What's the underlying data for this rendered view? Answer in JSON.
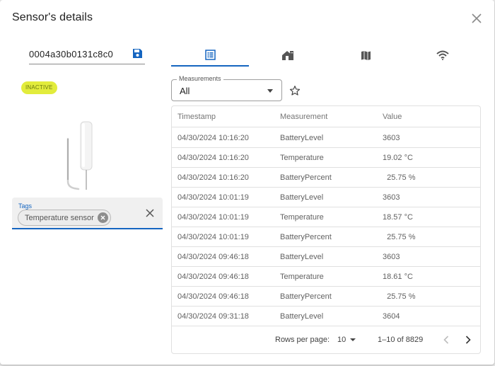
{
  "dialog": {
    "title": "Sensor's details",
    "close_icon": "close-icon"
  },
  "sensor": {
    "id": "0004a30b0131c8c0",
    "save_icon": "save-icon",
    "status": "INACTIVE",
    "image_icon": "temperature-probe-image"
  },
  "tags": {
    "label": "Tags",
    "chips": [
      "Temperature sensor"
    ],
    "clear_icon": "close-icon"
  },
  "tabs": [
    {
      "icon": "list-icon",
      "active": true
    },
    {
      "icon": "house-icon",
      "active": false
    },
    {
      "icon": "map-icon",
      "active": false
    },
    {
      "icon": "signal-icon",
      "active": false
    }
  ],
  "filter": {
    "label": "Measurements",
    "value": "All",
    "favorite_icon": "star-outline-icon"
  },
  "table": {
    "columns": [
      "Timestamp",
      "Measurement",
      "Value"
    ],
    "rows": [
      [
        "04/30/2024 10:16:20",
        "BatteryLevel",
        "3603"
      ],
      [
        "04/30/2024 10:16:20",
        "Temperature",
        "19.02 °C"
      ],
      [
        "04/30/2024 10:16:20",
        "BatteryPercent",
        "  25.75 %"
      ],
      [
        "04/30/2024 10:01:19",
        "BatteryLevel",
        "3603"
      ],
      [
        "04/30/2024 10:01:19",
        "Temperature",
        "18.57 °C"
      ],
      [
        "04/30/2024 10:01:19",
        "BatteryPercent",
        "  25.75 %"
      ],
      [
        "04/30/2024 09:46:18",
        "BatteryLevel",
        "3603"
      ],
      [
        "04/30/2024 09:46:18",
        "Temperature",
        "18.61 °C"
      ],
      [
        "04/30/2024 09:46:18",
        "BatteryPercent",
        "  25.75 %"
      ],
      [
        "04/30/2024 09:31:18",
        "BatteryLevel",
        "3604"
      ]
    ]
  },
  "pagination": {
    "rows_per_page_label": "Rows per page:",
    "rows_per_page": "10",
    "range": "1–10 of 8829"
  },
  "colors": {
    "accent": "#1565c0",
    "badge_bg": "#e2ec3c"
  }
}
